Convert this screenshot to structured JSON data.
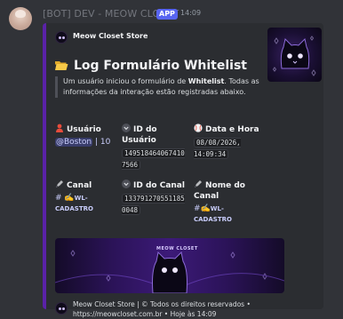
{
  "message": {
    "author": "[BOT] DEV - MEOW CLOSET",
    "app_badge": "APP",
    "timestamp": "14:09"
  },
  "embed": {
    "accent_color": "#5a22a8",
    "author_name": "Meow Closet Store",
    "title": "Log Formulário Whitelist",
    "title_icon": "open-folder-icon",
    "description": {
      "line_prefix": "Um usuário iniciou o formulário de ",
      "bold": "Whitelist",
      "line_suffix": ".",
      "line2": "Todas as informações da interação estão registradas abaixo."
    },
    "fields": {
      "usuario": {
        "name": "Usuário",
        "icon": "user-icon",
        "mention": "@Boston",
        "suffix": " | 10"
      },
      "id_usuario": {
        "name": "ID do Usuário",
        "icon": "chevron-down-icon",
        "value": "1495184640674107566"
      },
      "data_hora": {
        "name": "Data e Hora",
        "icon": "baseball-icon",
        "value": "08/08/2026, 14:09:34"
      },
      "canal": {
        "name": "Canal",
        "icon": "pen-nib-icon",
        "value_prefix": "# ",
        "value_name": "WL- CADASTRO"
      },
      "id_canal": {
        "name": "ID do Canal",
        "icon": "chevron-down-icon",
        "value": "1337912705511850048"
      },
      "nome_canal": {
        "name": "Nome do Canal",
        "icon": "pen-nib-icon",
        "value_prefix": "#",
        "value_name": "WL- CADASTRO"
      }
    },
    "banner_text": "MEOW CLOSET",
    "footer": {
      "line1": "Meow Closet Store | © Todos os direitos reservados •",
      "line2": "https://meowcloset.com.br • Hoje às 14:09"
    }
  }
}
